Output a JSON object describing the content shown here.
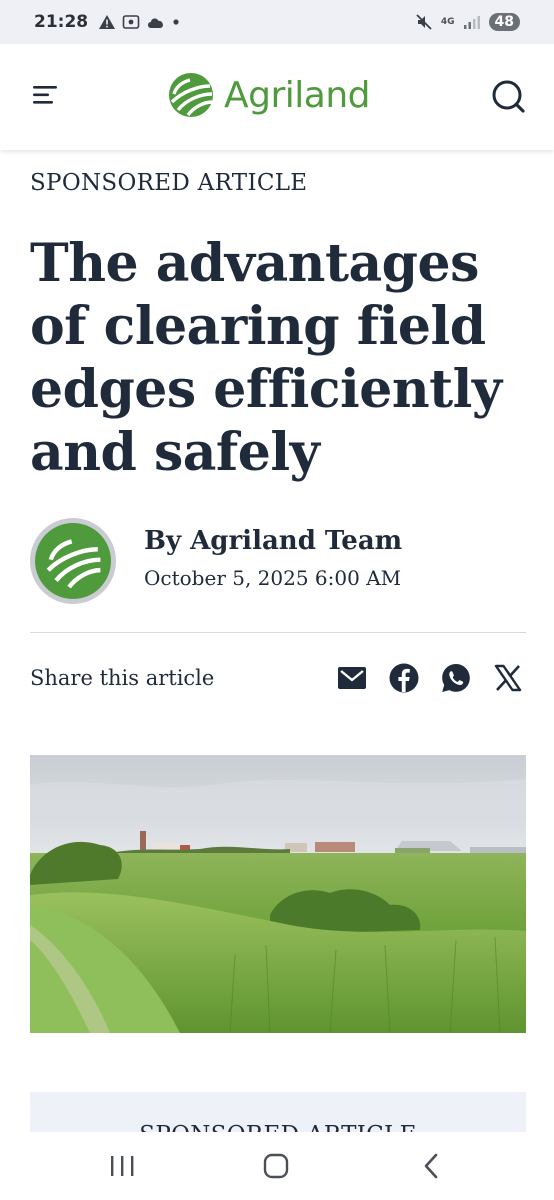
{
  "status_bar": {
    "time": "21:28",
    "network": "4G",
    "battery": "48"
  },
  "header": {
    "logo_text": "Agriland",
    "brand_color": "#4f9a3c",
    "icons": [
      "menu-icon",
      "search-icon"
    ]
  },
  "article": {
    "kicker": "SPONSORED ARTICLE",
    "title": "The advantages of clearing field edges efficiently and safely",
    "author": "By Agriland Team",
    "date": "October 5, 2025 6:00 AM",
    "share_label": "Share this article",
    "share_icons": [
      "email-icon",
      "facebook-icon",
      "whatsapp-icon",
      "x-icon"
    ]
  },
  "promo": {
    "kicker": "SPONSORED ARTICLE"
  },
  "nav_bar": {
    "icons": [
      "recent-apps-icon",
      "home-icon",
      "back-icon"
    ]
  }
}
